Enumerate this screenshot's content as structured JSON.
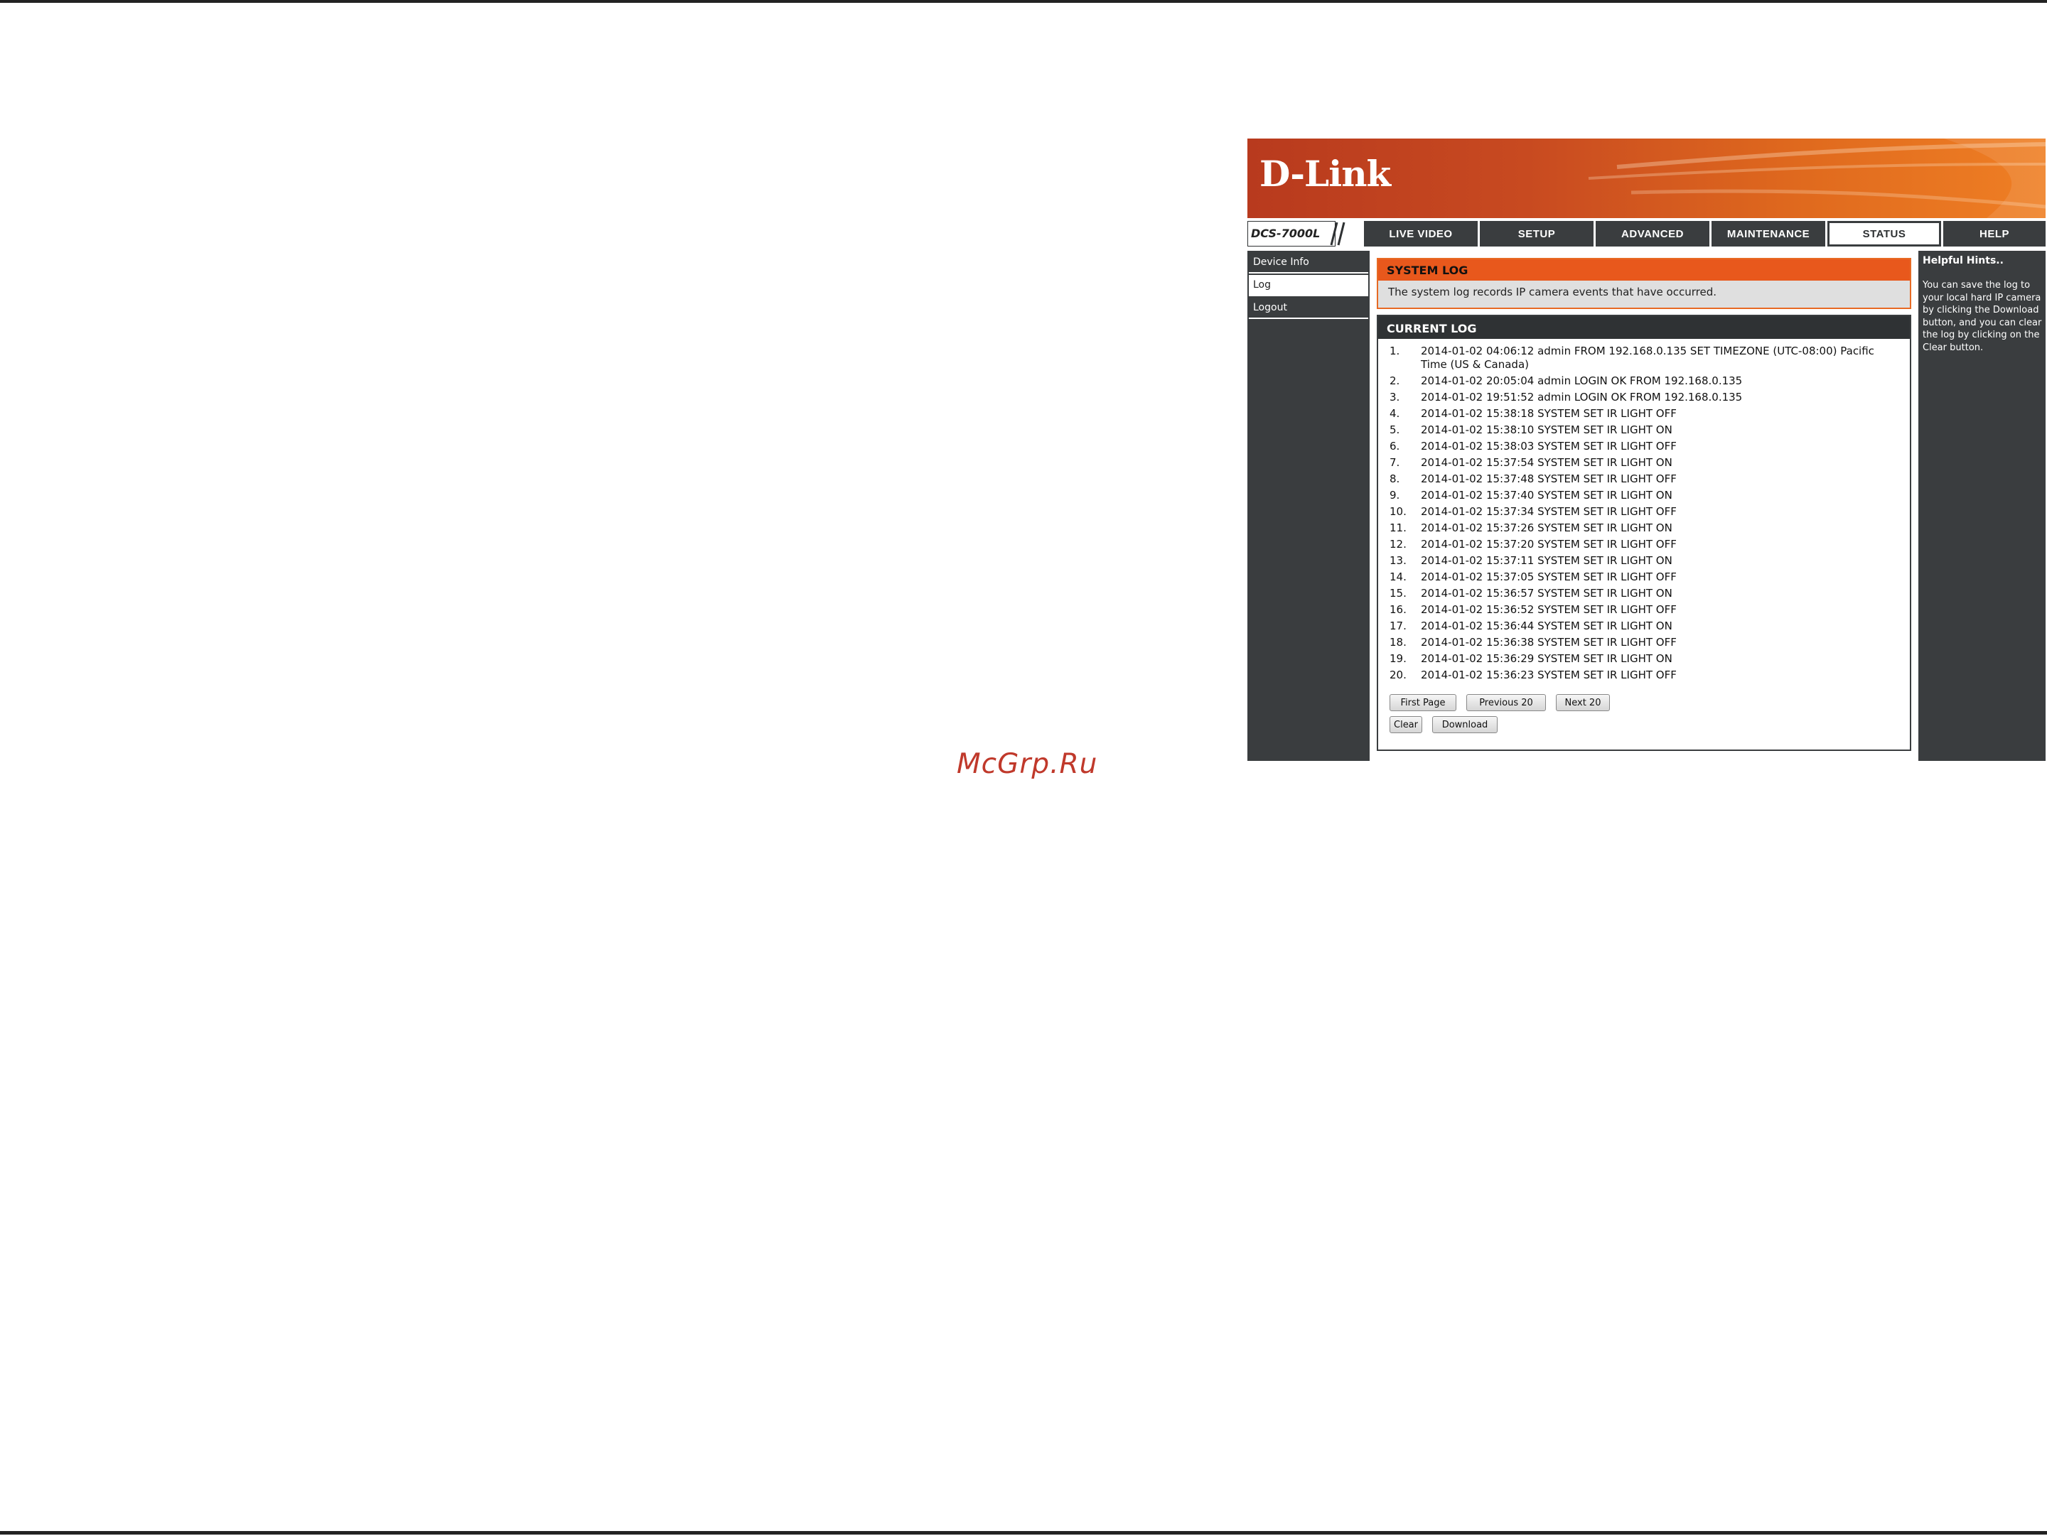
{
  "watermark": "McGrp.Ru",
  "brand": {
    "logo": "D-Link",
    "model": "DCS-7000L"
  },
  "colors": {
    "accent": "#e8581c",
    "dark": "#3a3d3f",
    "banner_start": "#b83a1e",
    "banner_end": "#ef7f24"
  },
  "nav": {
    "tabs": [
      {
        "label": "LIVE VIDEO"
      },
      {
        "label": "SETUP"
      },
      {
        "label": "ADVANCED"
      },
      {
        "label": "MAINTENANCE"
      },
      {
        "label": "STATUS",
        "active": true
      },
      {
        "label": "HELP"
      }
    ]
  },
  "sidebar": {
    "items": [
      {
        "label": "Device Info"
      },
      {
        "label": "Log",
        "active": true
      },
      {
        "label": "Logout"
      }
    ]
  },
  "system_log": {
    "title": "SYSTEM LOG",
    "description": "The system log records IP camera events that have occurred."
  },
  "current_log": {
    "title": "CURRENT LOG",
    "entries": [
      {
        "num": "1.",
        "text": "2014-01-02 04:06:12 admin FROM 192.168.0.135 SET TIMEZONE (UTC-08:00) Pacific Time (US & Canada)"
      },
      {
        "num": "2.",
        "text": "2014-01-02 20:05:04 admin LOGIN OK FROM 192.168.0.135"
      },
      {
        "num": "3.",
        "text": "2014-01-02 19:51:52 admin LOGIN OK FROM 192.168.0.135"
      },
      {
        "num": "4.",
        "text": "2014-01-02 15:38:18 SYSTEM SET IR LIGHT OFF"
      },
      {
        "num": "5.",
        "text": "2014-01-02 15:38:10 SYSTEM SET IR LIGHT ON"
      },
      {
        "num": "6.",
        "text": "2014-01-02 15:38:03 SYSTEM SET IR LIGHT OFF"
      },
      {
        "num": "7.",
        "text": "2014-01-02 15:37:54 SYSTEM SET IR LIGHT ON"
      },
      {
        "num": "8.",
        "text": "2014-01-02 15:37:48 SYSTEM SET IR LIGHT OFF"
      },
      {
        "num": "9.",
        "text": "2014-01-02 15:37:40 SYSTEM SET IR LIGHT ON"
      },
      {
        "num": "10.",
        "text": "2014-01-02 15:37:34 SYSTEM SET IR LIGHT OFF"
      },
      {
        "num": "11.",
        "text": "2014-01-02 15:37:26 SYSTEM SET IR LIGHT ON"
      },
      {
        "num": "12.",
        "text": "2014-01-02 15:37:20 SYSTEM SET IR LIGHT OFF"
      },
      {
        "num": "13.",
        "text": "2014-01-02 15:37:11 SYSTEM SET IR LIGHT ON"
      },
      {
        "num": "14.",
        "text": "2014-01-02 15:37:05 SYSTEM SET IR LIGHT OFF"
      },
      {
        "num": "15.",
        "text": "2014-01-02 15:36:57 SYSTEM SET IR LIGHT ON"
      },
      {
        "num": "16.",
        "text": "2014-01-02 15:36:52 SYSTEM SET IR LIGHT OFF"
      },
      {
        "num": "17.",
        "text": "2014-01-02 15:36:44 SYSTEM SET IR LIGHT ON"
      },
      {
        "num": "18.",
        "text": "2014-01-02 15:36:38 SYSTEM SET IR LIGHT OFF"
      },
      {
        "num": "19.",
        "text": "2014-01-02 15:36:29 SYSTEM SET IR LIGHT ON"
      },
      {
        "num": "20.",
        "text": "2014-01-02 15:36:23 SYSTEM SET IR LIGHT OFF"
      }
    ],
    "buttons": {
      "first_page": "First Page",
      "previous": "Previous 20",
      "next": "Next 20",
      "clear": "Clear",
      "download": "Download"
    }
  },
  "help": {
    "title": "Helpful Hints..",
    "text": "You can save the log to your local hard IP camera by clicking the Download button, and you can clear the log by clicking on the Clear button."
  }
}
